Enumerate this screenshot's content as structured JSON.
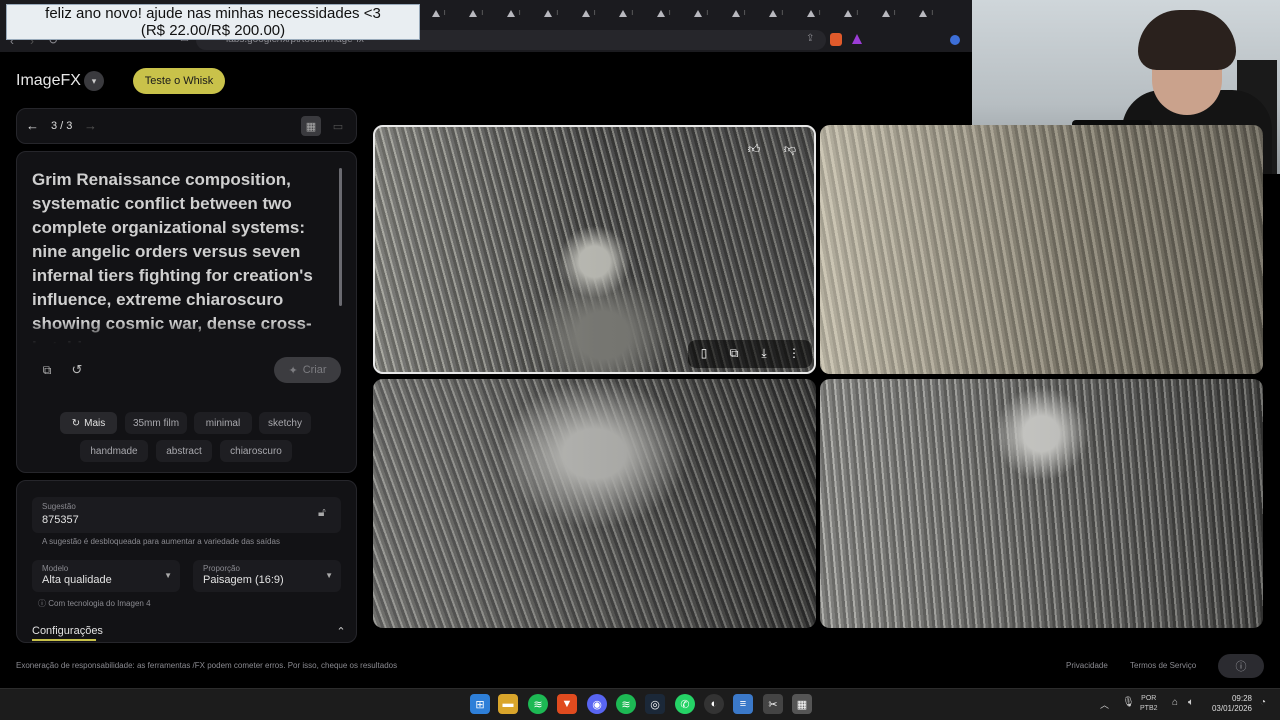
{
  "overlay": {
    "donation_line1": "feliz ano novo! ajude nas minhas necessidades <3",
    "donation_line2": "(R$ 22.00/R$ 200.00)"
  },
  "browser": {
    "address": "labs.google/fx/pt/tools/image-fx",
    "tab_label": "I"
  },
  "app": {
    "title": "ImageFX",
    "whisk_button": "Teste o Whisk"
  },
  "pager": {
    "count": "3 / 3"
  },
  "prompt": {
    "text": "Grim Renaissance composition, systematic conflict between two complete organizational systems: nine angelic orders versus seven infernal tiers fighting for creation's influence, extreme chiaroscuro showing cosmic war, dense cross-hatching"
  },
  "actions": {
    "create_label": "Criar"
  },
  "chips": {
    "more": "Mais",
    "items": [
      "35mm film",
      "minimal",
      "sketchy",
      "handmade",
      "abstract",
      "chiaroscuro"
    ]
  },
  "settings": {
    "seed_label": "Sugestão",
    "seed_value": "875357",
    "seed_help": "A sugestão é desbloqueada para aumentar a variedade das saídas",
    "model_label": "Modelo",
    "model_value": "Alta qualidade",
    "ratio_label": "Proporção",
    "ratio_value": "Paisagem (16:9)",
    "tech_note": "Com tecnologia do Imagen 4",
    "config_label": "Configurações"
  },
  "footer": {
    "disclaimer": "Exoneração de responsabilidade: as ferramentas /FX podem cometer erros. Por isso, cheque os resultados",
    "privacy": "Privacidade",
    "terms": "Termos de Serviço"
  },
  "taskbar": {
    "lang_line1": "POR",
    "lang_line2": "PTB2",
    "time": "09:28",
    "date": "03/01/2026"
  },
  "colors": {
    "accent": "#c9c24a",
    "background": "#000000",
    "panel": "#121215"
  }
}
